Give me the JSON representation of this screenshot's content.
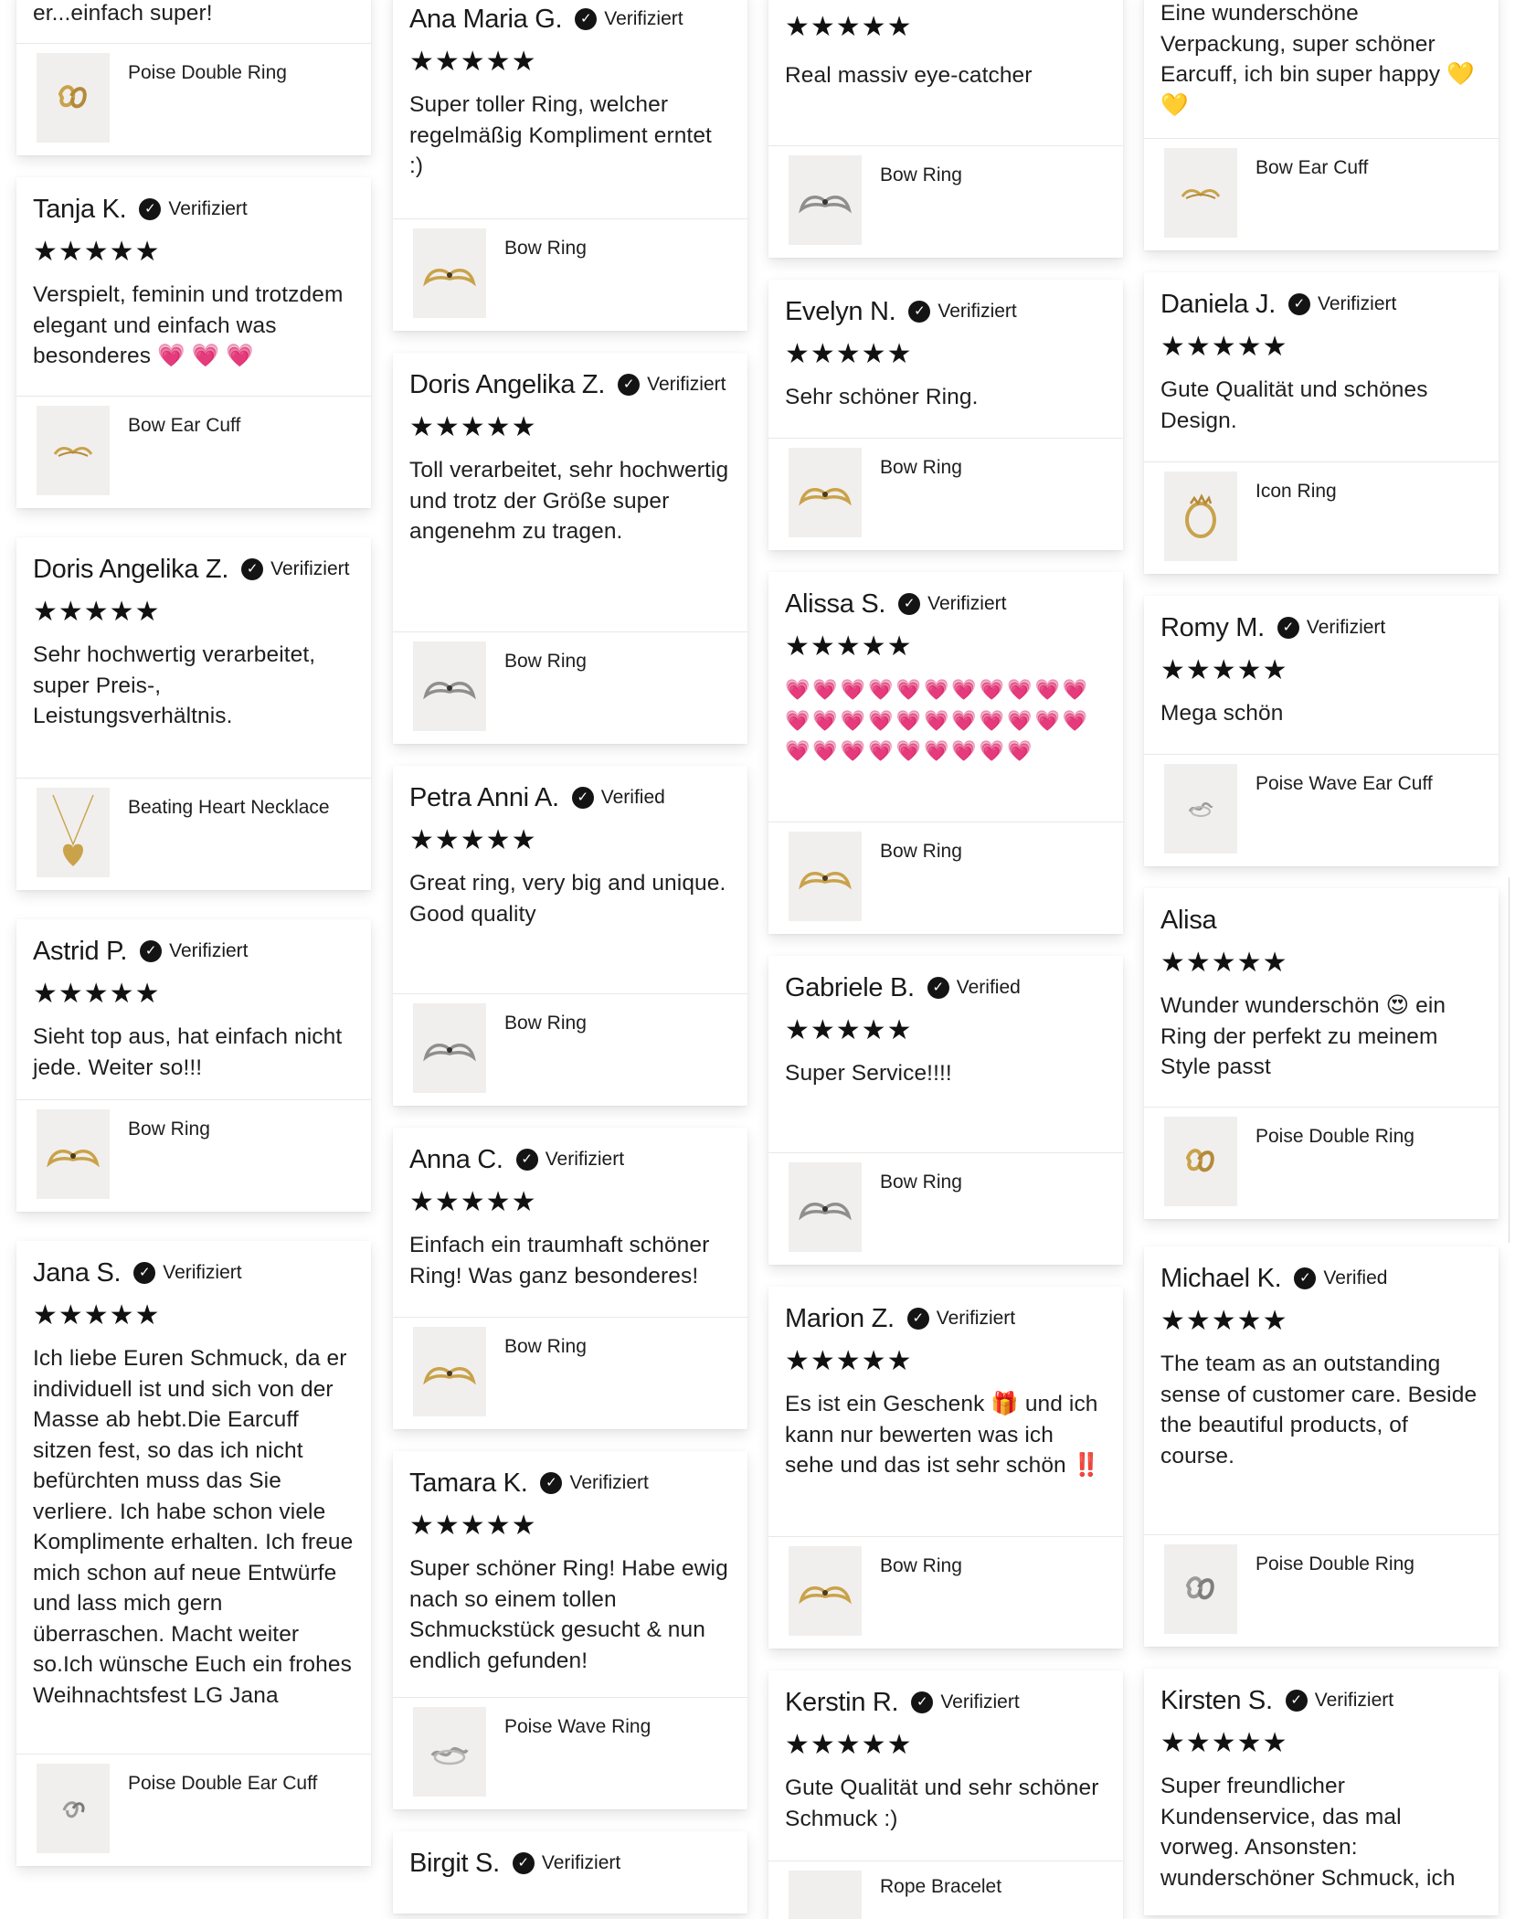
{
  "verified_labels": {
    "de": "Verifiziert",
    "en": "Verified"
  },
  "rating_stars": "★★★★★",
  "columns": [
    {
      "cards": [
        {
          "text": "er...einfach super!",
          "product": "Poise Double Ring",
          "thumb": "gold-double-ring"
        },
        {
          "name": "Tanja K.",
          "verified": "Verifiziert",
          "text": "Verspielt, feminin und trotzdem elegant und einfach was besonderes 💗 💗 💗",
          "product": "Bow Ear Cuff",
          "thumb": "gold-bow-ear-cuff"
        },
        {
          "name": "Doris Angelika Z.",
          "verified": "Verifiziert",
          "text": "Sehr hochwertig verarbeitet, super Preis-, Leistungsverhältnis.",
          "product": "Beating Heart Necklace",
          "thumb": "gold-heart-necklace"
        },
        {
          "name": "Astrid P.",
          "verified": "Verifiziert",
          "text": "Sieht top aus, hat einfach nicht jede. Weiter so!!!",
          "product": "Bow Ring",
          "thumb": "gold-bow-ring"
        },
        {
          "name": "Jana S.",
          "verified": "Verifiziert",
          "text": "Ich liebe Euren Schmuck,  da er individuell ist und sich von der  Masse ab hebt.Die Earcuff sitzen fest,  so das ich nicht befürchten muss das Sie verliere. Ich habe schon viele Komplimente erhalten. Ich freue mich schon auf neue Entwürfe und lass mich gern überraschen. Macht weiter so.Ich wünsche Euch ein frohes Weihnachtsfest LG Jana",
          "product": "Poise Double Ear Cuff",
          "thumb": "silver-double-ear-cuff"
        }
      ]
    },
    {
      "cards": [
        {
          "name": "Ana Maria G.",
          "verified": "Verifiziert",
          "text": "Super toller Ring, welcher regelmäßig Kompliment erntet :)",
          "product": "Bow Ring",
          "thumb": "gold-bow-ring"
        },
        {
          "name": "Doris Angelika Z.",
          "verified": "Verifiziert",
          "text": "Toll verarbeitet, sehr hochwertig und trotz der Größe super angenehm zu tragen.",
          "product": "Bow Ring",
          "thumb": "silver-bow-ring"
        },
        {
          "name": "Petra Anni A.",
          "verified": "Verified",
          "text": "Great ring, very big and unique. Good quality",
          "product": "Bow Ring",
          "thumb": "silver-bow-ring"
        },
        {
          "name": "Anna C.",
          "verified": "Verifiziert",
          "text": "Einfach ein traumhaft schöner Ring! Was ganz besonderes!",
          "product": "Bow Ring",
          "thumb": "gold-bow-ring"
        },
        {
          "name": "Tamara K.",
          "verified": "Verifiziert",
          "text": "Super schöner Ring! Habe ewig nach so einem tollen Schmuckstück gesucht & nun endlich gefunden!",
          "product": "Poise Wave Ring",
          "thumb": "silver-wave-ring"
        },
        {
          "name": "Birgit S.",
          "verified": "Verifiziert"
        }
      ]
    },
    {
      "cards": [
        {
          "text": "Real massiv eye-catcher",
          "product": "Bow Ring",
          "thumb": "silver-bow-ring"
        },
        {
          "name": "Evelyn N.",
          "verified": "Verifiziert",
          "text": "Sehr schöner Ring.",
          "product": "Bow Ring",
          "thumb": "gold-bow-ring"
        },
        {
          "name": "Alissa S.",
          "verified": "Verifiziert",
          "hearts": 31,
          "product": "Bow Ring",
          "thumb": "gold-bow-ring"
        },
        {
          "name": "Gabriele B.",
          "verified": "Verified",
          "text": "Super Service!!!!",
          "product": "Bow Ring",
          "thumb": "silver-bow-ring"
        },
        {
          "name": "Marion Z.",
          "verified": "Verifiziert",
          "text": "Es ist ein Geschenk 🎁 und ich kann nur bewerten was ich sehe und das ist sehr schön ‼️",
          "product": "Bow Ring",
          "thumb": "gold-bow-ring"
        },
        {
          "name": "Kerstin R.",
          "verified": "Verifiziert",
          "text": "Gute Qualität und sehr schöner Schmuck :)",
          "product": "Rope Bracelet",
          "thumb": "gold-rope-bracelet"
        }
      ]
    },
    {
      "cards": [
        {
          "text": "Eine wunderschöne Verpackung, super schöner Earcuff, ich bin super happy 💛 💛",
          "product": "Bow Ear Cuff",
          "thumb": "gold-bow-ear-cuff"
        },
        {
          "name": "Daniela J.",
          "verified": "Verifiziert",
          "text": "Gute Qualität und schönes Design.",
          "product": "Icon Ring",
          "thumb": "gold-icon-ring"
        },
        {
          "name": "Romy M.",
          "verified": "Verifiziert",
          "text": "Mega schön",
          "product": "Poise Wave Ear Cuff",
          "thumb": "silver-wave-ear-cuff"
        },
        {
          "name": "Alisa",
          "text": "Wunder wunderschön 😍 ein Ring der perfekt zu meinem Style passt",
          "product": "Poise Double Ring",
          "thumb": "gold-double-ring"
        },
        {
          "name": "Michael K.",
          "verified": "Verified",
          "text": "The team as an outstanding sense of customer care. Beside the beautiful products, of course.",
          "product": "Poise Double Ring",
          "thumb": "silver-double-ring"
        },
        {
          "name": "Kirsten S.",
          "verified": "Verifiziert",
          "text": "Super freundlicher Kundenservice, das mal vorweg. Ansonsten: wunderschöner Schmuck, ich"
        }
      ]
    }
  ],
  "colors": {
    "gold": "#c9a24a",
    "silver": "#9a9a9a",
    "thumb_bg": "#f1efed",
    "heart": "#e8336e"
  }
}
